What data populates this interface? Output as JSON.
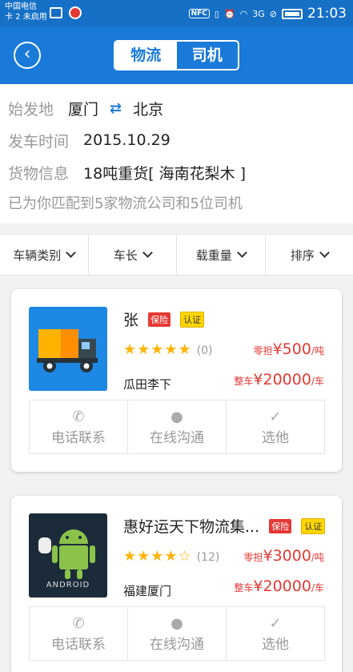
{
  "status_bar": {
    "carrier_line1": "中国电信",
    "carrier_line2": "卡 2 未启用",
    "nfc": "NFC",
    "signal_3g": "3G",
    "time": "21:03"
  },
  "header": {
    "back_icon": "chevron-left-icon",
    "tabs": [
      {
        "label": "物流",
        "active": true
      },
      {
        "label": "司机",
        "active": false
      }
    ],
    "accent_color": "#1a7ad9"
  },
  "route": {
    "origin_label": "始发地",
    "origin": "厦门",
    "destination": "北京",
    "depart_label": "发车时间",
    "depart_date": "2015.10.29",
    "cargo_label": "货物信息",
    "cargo": "18吨重货[ 海南花梨木 ]",
    "match_text": "已为你匹配到5家物流公司和5位司机"
  },
  "filters": [
    "车辆类别",
    "车长",
    "载重量",
    "排序"
  ],
  "cards": [
    {
      "name": "张",
      "badge_insurance": "保险",
      "badge_cert": "认证",
      "rating": 5,
      "stars": "★★★★★",
      "review_count": "(0)",
      "price_partial_label": "零担",
      "price_partial": "¥500",
      "price_partial_unit": "/吨",
      "price_full_label": "整车",
      "price_full": "¥20000",
      "price_full_unit": "/车",
      "location": "瓜田李下",
      "thumb_icon": "truck-icon",
      "actions": [
        "电话联系",
        "在线沟通",
        "选他"
      ]
    },
    {
      "name": "惠好运天下物流集...",
      "badge_insurance": "保险",
      "badge_cert": "认证",
      "rating": 4.5,
      "stars": "★★★★☆",
      "review_count": "(12)",
      "price_partial_label": "零担",
      "price_partial": "¥3000",
      "price_partial_unit": "/吨",
      "price_full_label": "整车",
      "price_full": "¥20000",
      "price_full_unit": "/车",
      "location": "福建厦门",
      "thumb_icon": "android-icon",
      "thumb_text": "ANDROID",
      "actions": [
        "电话联系",
        "在线沟通",
        "选他"
      ]
    }
  ]
}
